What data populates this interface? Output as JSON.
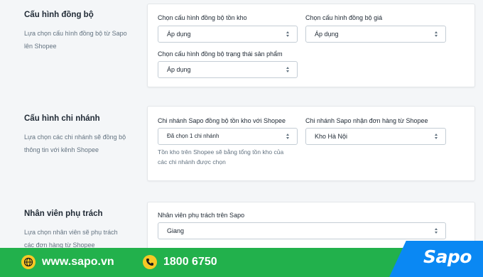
{
  "sections": {
    "sync": {
      "title": "Cấu hình đồng bộ",
      "desc_line1": "Lựa chọn cấu hình đồng bộ từ Sapo",
      "desc_line2": "lên Shopee",
      "fields": {
        "inventory_label": "Chọn cấu hình đồng bộ tồn kho",
        "inventory_value": "Áp dụng",
        "price_label": "Chọn cấu hình đồng bộ giá",
        "price_value": "Áp dụng",
        "status_label": "Chọn cấu hình đồng bộ trạng thái sản phẩm",
        "status_value": "Áp dụng"
      }
    },
    "branch": {
      "title": "Cấu hình chi nhánh",
      "desc_line1": "Lựa chọn các chi nhánh sẽ đồng bộ",
      "desc_line2": "thông tin với kênh Shopee",
      "fields": {
        "sync_branch_label": "Chi nhánh Sapo đồng bộ tồn kho với Shopee",
        "sync_branch_value": "Đã chọn 1 chi nhánh",
        "help_line1": "Tồn kho trên Shopee sẽ bằng tổng tồn kho của",
        "help_line2": "các chi nhánh được chọn",
        "order_branch_label": "Chi nhánh Sapo nhận đơn hàng từ Shopee",
        "order_branch_value": "Kho Hà Nội"
      }
    },
    "staff": {
      "title": "Nhân viên phụ trách",
      "desc_line1": "Lựa chọn nhân viên sẽ phụ trách",
      "desc_line2": "các đơn hàng từ Shopee",
      "fields": {
        "staff_label": "Nhân viên phụ trách trên Sapo",
        "staff_value": "Giang"
      }
    }
  },
  "footer": {
    "website": "www.sapo.vn",
    "phone": "1800 6750",
    "logo": "Sapo",
    "website_icon": "globe-icon",
    "phone_icon": "phone-icon"
  },
  "colors": {
    "footer_green": "#22b14c",
    "logo_blue": "#0a88f3",
    "icon_yellow": "#f7c825"
  }
}
